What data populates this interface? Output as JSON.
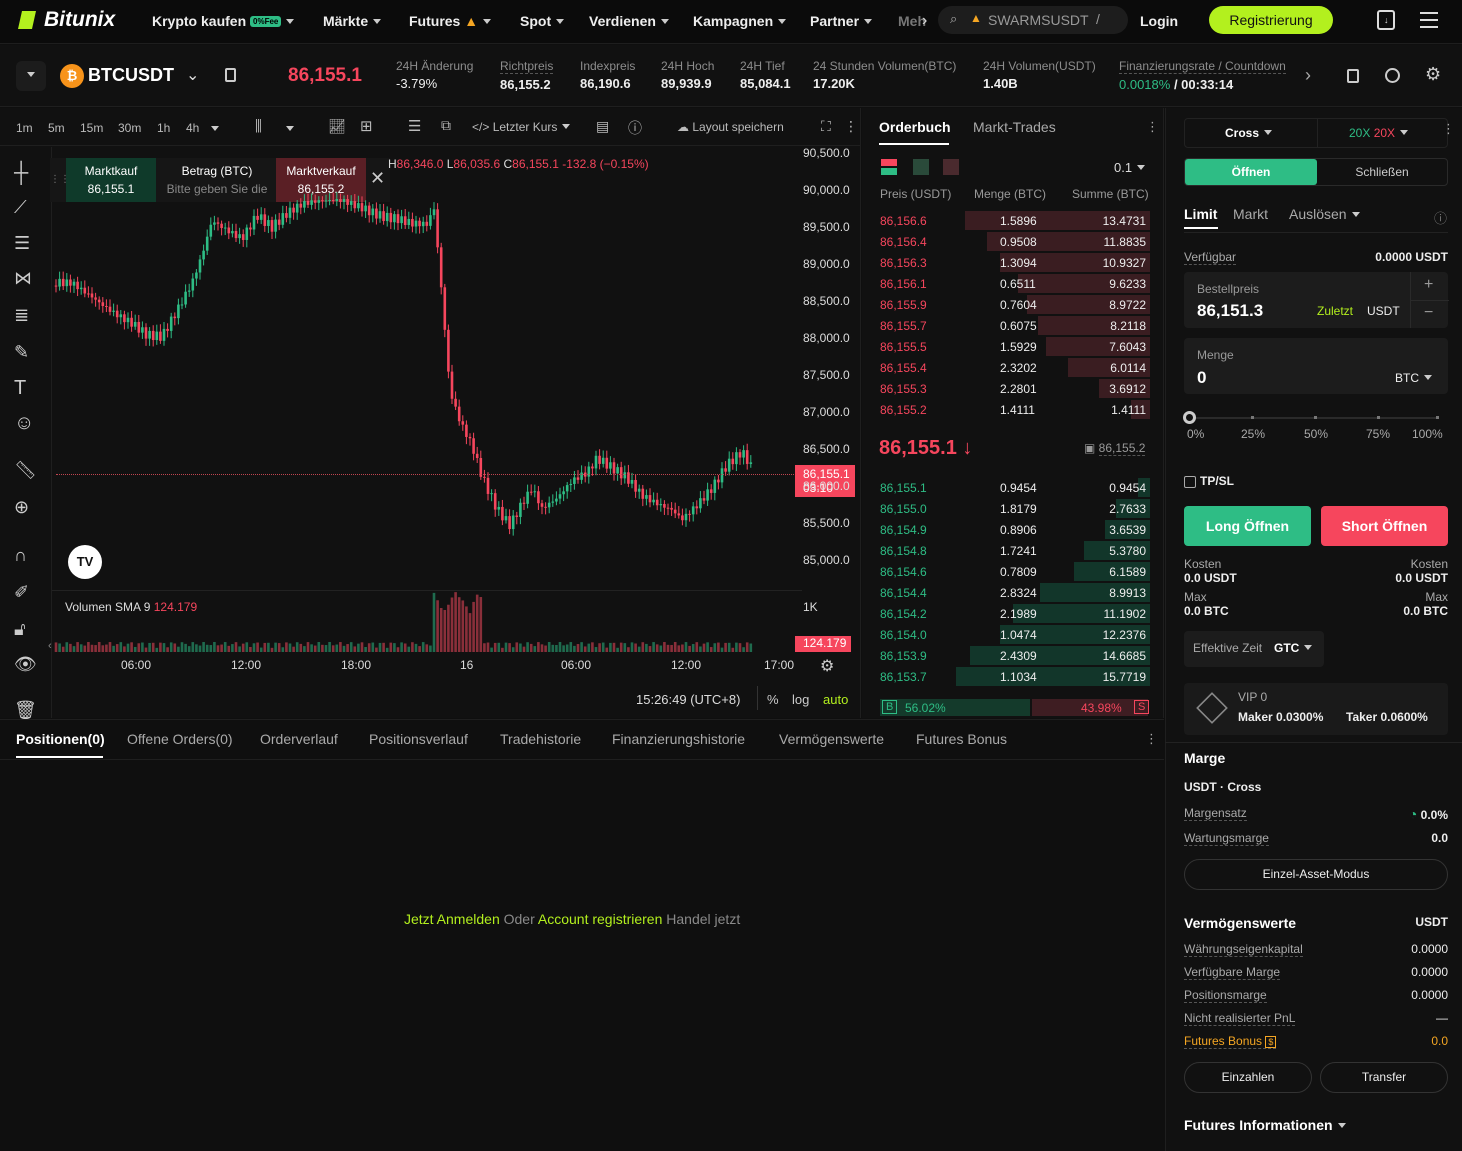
{
  "nav": {
    "logo": "Bitunix",
    "items": [
      {
        "label": "Krypto kaufen",
        "badge": "0%Fee"
      },
      {
        "label": "Märkte"
      },
      {
        "label": "Futures"
      },
      {
        "label": "Spot"
      },
      {
        "label": "Verdienen"
      },
      {
        "label": "Kampagnen"
      },
      {
        "label": "Partner"
      },
      {
        "label": "Meh"
      }
    ],
    "search": "SWARMSUSDT",
    "login": "Login",
    "register": "Registrierung"
  },
  "ticker": {
    "symbol": "BTCUSDT",
    "price": "86,155.1",
    "stats": [
      {
        "label": "24H Änderung",
        "value": "-3.79%"
      },
      {
        "label": "Richtpreis",
        "value": "86,155.2"
      },
      {
        "label": "Indexpreis",
        "value": "86,190.6"
      },
      {
        "label": "24H Hoch",
        "value": "89,939.9"
      },
      {
        "label": "24H Tief",
        "value": "85,084.1"
      },
      {
        "label": "24 Stunden Volumen(BTC)",
        "value": "17.20K"
      },
      {
        "label": "24H Volumen(USDT)",
        "value": "1.40B"
      },
      {
        "label": "Finanzierungsrate / Countdown",
        "value": "0.0018%",
        "value2": "/ 00:33:14"
      }
    ]
  },
  "chart_toolbar": {
    "intervals": [
      "1m",
      "5m",
      "15m",
      "30m",
      "1h",
      "4h"
    ],
    "price_type": "Letzter Kurs",
    "save_layout": "Layout speichern"
  },
  "quick_trade": {
    "buy_label": "Marktkauf",
    "buy_price": "86,155.1",
    "amount_label": "Betrag (BTC)",
    "amount_placeholder": "Bitte geben Sie die",
    "sell_label": "Marktverkauf",
    "sell_price": "86,155.2"
  },
  "ohlc": {
    "h": "86,346.0",
    "l": "86,035.6",
    "c": "86,155.1",
    "chg": "-132.8 (−0.15%)"
  },
  "chart_data": {
    "type": "candlestick",
    "y_ticks": [
      "90,500.0",
      "90,000.0",
      "89,500.0",
      "89,000.0",
      "88,500.0",
      "88,000.0",
      "87,500.0",
      "87,000.0",
      "86,500.0",
      "86,000.0",
      "85,500.0",
      "85,000.0"
    ],
    "x_ticks": [
      "06:00",
      "12:00",
      "18:00",
      "16",
      "06:00",
      "12:00",
      "17:00"
    ],
    "last_price": "86,155.1",
    "countdown": "03:10",
    "volume_label": "Volumen SMA 9",
    "volume_value": "124.179",
    "volume_axis": "1K",
    "time": "15:26:49 (UTC+8)",
    "scale_opts": [
      "%",
      "log",
      "auto"
    ]
  },
  "orderbook": {
    "tabs": [
      "Orderbuch",
      "Markt-Trades"
    ],
    "step": "0.1",
    "headers": [
      "Preis (USDT)",
      "Menge (BTC)",
      "Summe (BTC)"
    ],
    "asks": [
      [
        "86,156.6",
        "1.5896",
        "13.4731"
      ],
      [
        "86,156.4",
        "0.9508",
        "11.8835"
      ],
      [
        "86,156.3",
        "1.3094",
        "10.9327"
      ],
      [
        "86,156.1",
        "0.6511",
        "9.6233"
      ],
      [
        "86,155.9",
        "0.7604",
        "8.9722"
      ],
      [
        "86,155.7",
        "0.6075",
        "8.2118"
      ],
      [
        "86,155.5",
        "1.5929",
        "7.6043"
      ],
      [
        "86,155.4",
        "2.3202",
        "6.0114"
      ],
      [
        "86,155.3",
        "2.2801",
        "3.6912"
      ],
      [
        "86,155.2",
        "1.4111",
        "1.4111"
      ]
    ],
    "mid": "86,155.1",
    "mark": "86,155.2",
    "bids": [
      [
        "86,155.1",
        "0.9454",
        "0.9454"
      ],
      [
        "86,155.0",
        "1.8179",
        "2.7633"
      ],
      [
        "86,154.9",
        "0.8906",
        "3.6539"
      ],
      [
        "86,154.8",
        "1.7241",
        "5.3780"
      ],
      [
        "86,154.6",
        "0.7809",
        "6.1589"
      ],
      [
        "86,154.4",
        "2.8324",
        "8.9913"
      ],
      [
        "86,154.2",
        "2.1989",
        "11.1902"
      ],
      [
        "86,154.0",
        "1.0474",
        "12.2376"
      ],
      [
        "86,153.9",
        "2.4309",
        "14.6685"
      ],
      [
        "86,153.7",
        "1.1034",
        "15.7719"
      ]
    ],
    "buy_pct": "56.02%",
    "sell_pct": "43.98%"
  },
  "positions": {
    "tabs": [
      "Positionen(0)",
      "Offene Orders(0)",
      "Orderverlauf",
      "Positionsverlauf",
      "Tradehistorie",
      "Finanzierungshistorie",
      "Vermögenswerte",
      "Futures Bonus"
    ],
    "login": "Jetzt Anmelden",
    "or": "Oder",
    "register": "Account registrieren",
    "tail": "Handel jetzt"
  },
  "order_form": {
    "margin_mode": "Cross",
    "lev_long": "20X",
    "lev_short": "20X",
    "open": "Öffnen",
    "close": "Schließen",
    "types": [
      "Limit",
      "Markt",
      "Auslösen"
    ],
    "avail_label": "Verfügbar",
    "avail": "0.0000 USDT",
    "price_label": "Bestellpreis",
    "price": "86,151.3",
    "latest": "Zuletzt",
    "price_unit": "USDT",
    "qty_label": "Menge",
    "qty": "0",
    "qty_unit": "BTC",
    "pcts": [
      "0%",
      "25%",
      "50%",
      "75%",
      "100%"
    ],
    "tpsl": "TP/SL",
    "long": "Long Öffnen",
    "short": "Short Öffnen",
    "cost": "Kosten",
    "cost_l": "0.0 USDT",
    "cost_r": "0.0 USDT",
    "max": "Max",
    "max_l": "0.0 BTC",
    "max_r": "0.0 BTC",
    "tif_label": "Effektive Zeit",
    "tif": "GTC",
    "vip": "VIP 0",
    "maker": "Maker 0.0300%",
    "taker": "Taker 0.0600%"
  },
  "margin": {
    "title": "Marge",
    "mode": "USDT · Cross",
    "rate_label": "Margensatz",
    "rate": "0.0%",
    "maint_label": "Wartungsmarge",
    "maint": "0.0",
    "asset_mode": "Einzel-Asset-Modus"
  },
  "assets": {
    "title": "Vermögenswerte",
    "unit": "USDT",
    "rows": [
      [
        "Währungseigenkapital",
        "0.0000"
      ],
      [
        "Verfügbare Marge",
        "0.0000"
      ],
      [
        "Positionsmarge",
        "0.0000"
      ],
      [
        "Nicht realisierter PnL",
        "—"
      ],
      [
        "Futures Bonus",
        "0.0"
      ]
    ],
    "deposit": "Einzahlen",
    "transfer": "Transfer",
    "info": "Futures Informationen"
  }
}
